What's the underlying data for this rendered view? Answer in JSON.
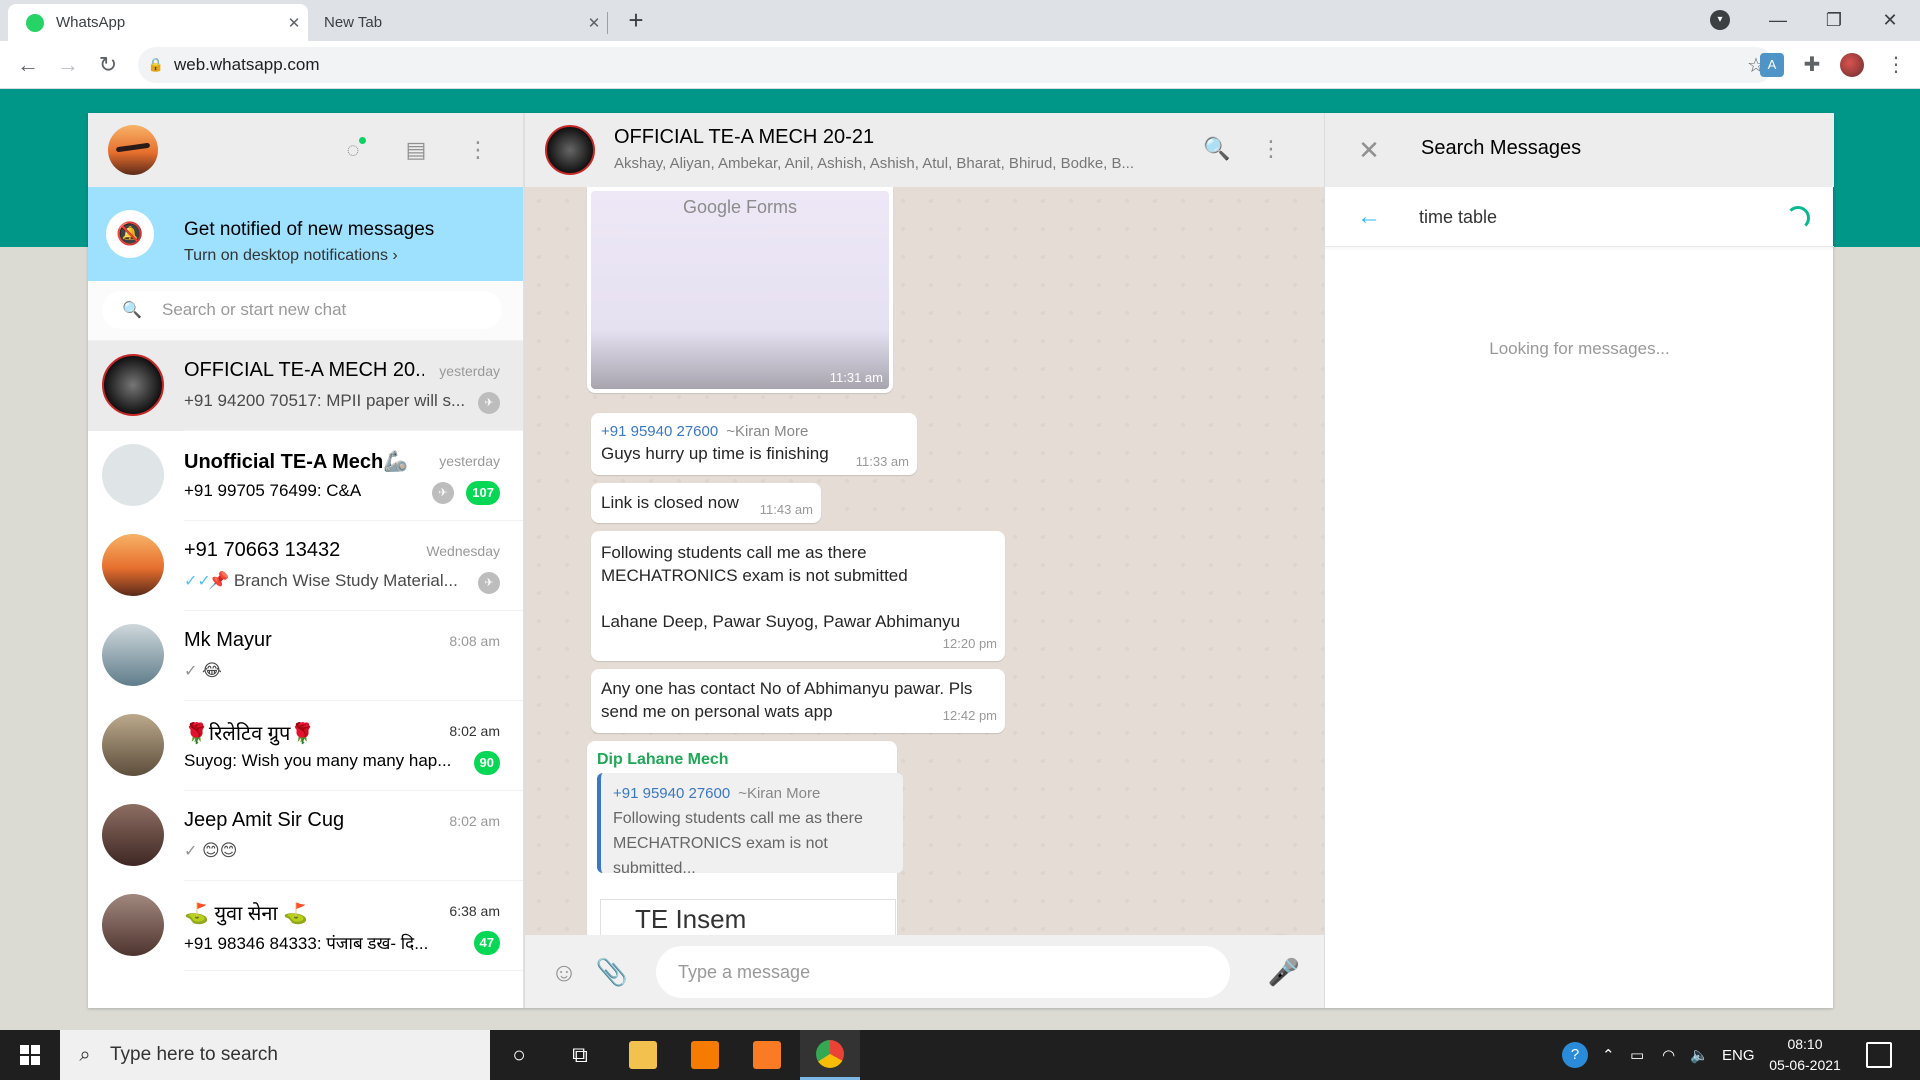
{
  "browser": {
    "tabs": [
      {
        "title": "WhatsApp",
        "active": true
      },
      {
        "title": "New Tab",
        "active": false
      }
    ],
    "url": "web.whatsapp.com",
    "new_tab_glyph": "+"
  },
  "left": {
    "notification": {
      "title": "Get notified of new messages",
      "subtitle": "Turn on desktop notifications ›"
    },
    "search_placeholder": "Search or start new chat",
    "chats": [
      {
        "name": "OFFICIAL TE-A MECH 20...",
        "time": "yesterday",
        "message": "+91 94200 70517: MPII paper will s...",
        "pinned": true,
        "badge": null
      },
      {
        "name": "Unofficial TE-A Mech🦾",
        "time": "yesterday",
        "message": "+91 99705 76499: C&A",
        "pinned": true,
        "badge": "107"
      },
      {
        "name": "+91 70663 13432",
        "time": "Wednesday",
        "message": "📌 Branch Wise Study Material...",
        "pinned": true,
        "badge": null
      },
      {
        "name": "Mk Mayur",
        "time": "8:08 am",
        "message": "😂",
        "pinned": false,
        "badge": null
      },
      {
        "name": "🌹रिलेटिव ग्रुप🌹",
        "time": "8:02 am",
        "message": "Suyog: Wish you many many hap...",
        "pinned": false,
        "badge": "90"
      },
      {
        "name": "Jeep Amit Sir Cug",
        "time": "8:02 am",
        "message": "😊😊",
        "pinned": false,
        "badge": null
      },
      {
        "name": "⛳ युवा सेना ⛳",
        "time": "6:38 am",
        "message": "+91 98346 84333: पंजाब डख- दि...",
        "pinned": false,
        "badge": "47"
      }
    ]
  },
  "conversation": {
    "group_name": "OFFICIAL TE-A MECH 20-21",
    "members": "Akshay, Aliyan, Ambekar, Anil, Ashish, Ashish, Atul, Bharat, Bhirud, Bodke, B...",
    "forms_label": "Google Forms",
    "forms_time": "11:31 am",
    "messages": [
      {
        "sender_number": "+91 95940 27600",
        "sender_alias": "~Kiran More",
        "text": "Guys hurry up time is finishing",
        "time": "11:33 am"
      },
      {
        "text": "Link is closed now",
        "time": "11:43 am"
      },
      {
        "text_line1": "Following students call me as there",
        "text_line2": "MECHATRONICS exam is not submitted",
        "text_line3": "Lahane Deep, Pawar Suyog, Pawar Abhimanyu",
        "time": "12:20 pm"
      },
      {
        "text_line1": "Any one has contact No of Abhimanyu pawar. Pls",
        "text_line2": "send me on personal wats app",
        "time": "12:42 pm"
      }
    ],
    "reply": {
      "sender": "Dip Lahane Mech",
      "quoted_number": "+91 95940 27600",
      "quoted_alias": "~Kiran More",
      "quoted_line1": "Following students call me as there",
      "quoted_line2": "MECHATRONICS exam is not",
      "quoted_line3": "submitted...",
      "attachment_title": "TE Insem"
    },
    "input_placeholder": "Type a message"
  },
  "search_panel": {
    "title": "Search Messages",
    "query": "time table",
    "status": "Looking for messages..."
  },
  "taskbar": {
    "search_placeholder": "Type here to search",
    "language": "ENG",
    "time": "08:10",
    "date": "05-06-2021"
  },
  "colors": {
    "wa_teal": "#009688",
    "badge_green": "#06d755",
    "link_blue": "#3a77c4",
    "reply_green": "#1fa855"
  }
}
